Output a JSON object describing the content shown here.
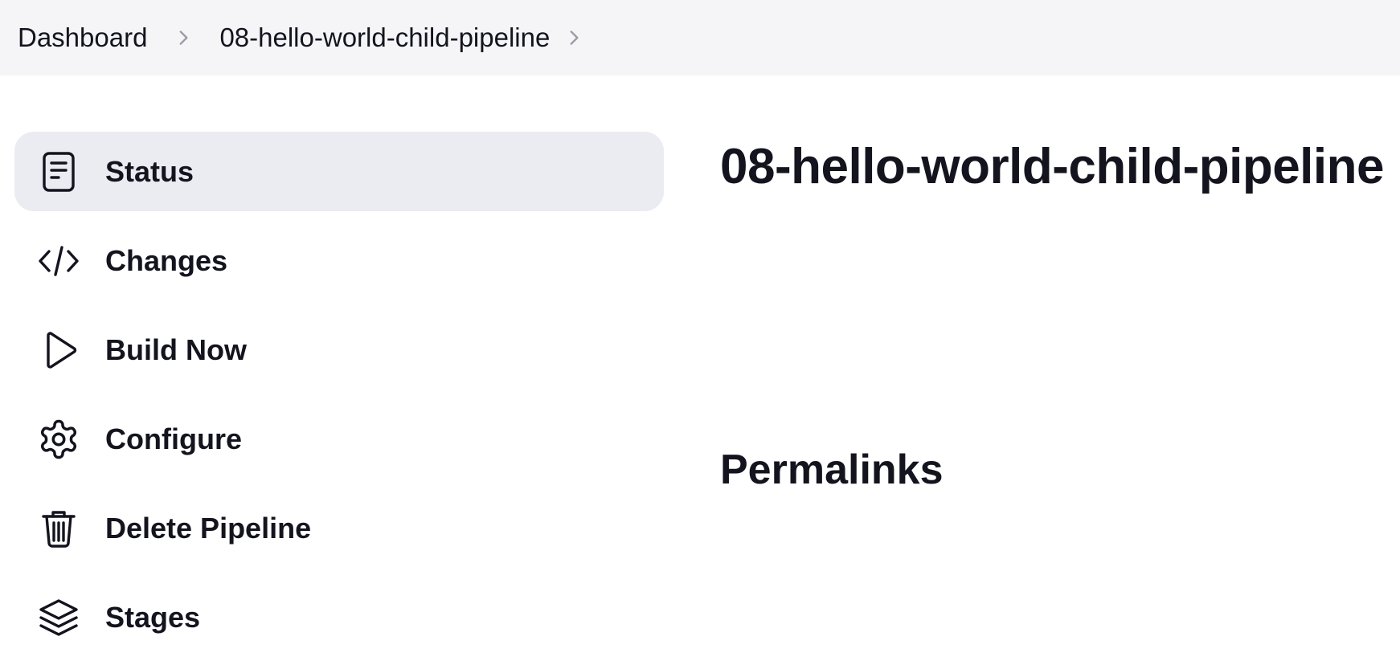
{
  "breadcrumb": {
    "items": [
      {
        "label": "Dashboard"
      },
      {
        "label": "08-hello-world-child-pipeline"
      }
    ]
  },
  "sidebar": {
    "items": [
      {
        "label": "Status",
        "icon": "document-icon",
        "active": true
      },
      {
        "label": "Changes",
        "icon": "code-icon",
        "active": false
      },
      {
        "label": "Build Now",
        "icon": "play-icon",
        "active": false
      },
      {
        "label": "Configure",
        "icon": "gear-icon",
        "active": false
      },
      {
        "label": "Delete Pipeline",
        "icon": "trash-icon",
        "active": false
      },
      {
        "label": "Stages",
        "icon": "layers-icon",
        "active": false
      }
    ]
  },
  "main": {
    "title": "08-hello-world-child-pipeline",
    "permalinks_heading": "Permalinks"
  },
  "colors": {
    "topbar_bg": "#f5f5f8",
    "active_item_bg": "#ebecf1",
    "text": "#14141f",
    "chevron": "#9b9ba5"
  }
}
